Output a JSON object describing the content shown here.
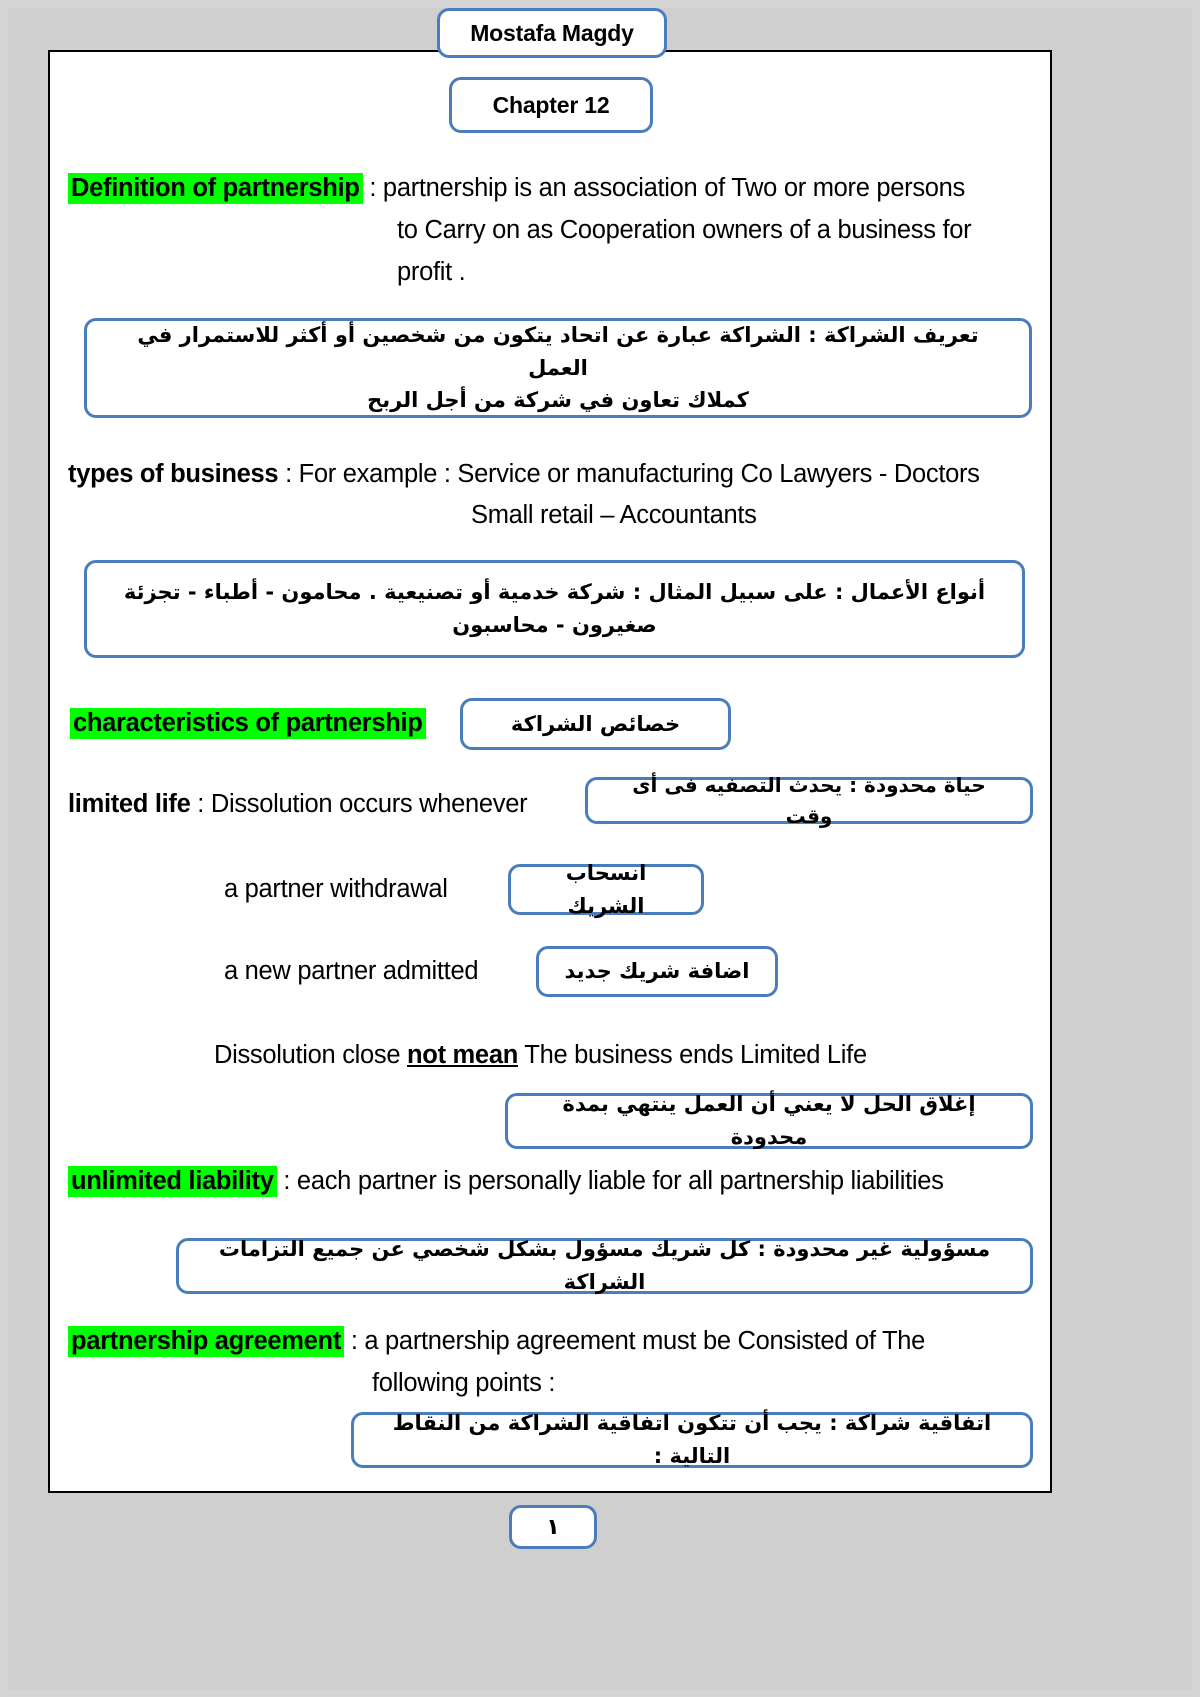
{
  "document": {
    "author_box": "Mostafa Magdy",
    "chapter_box": "Chapter 12",
    "page_number": "١"
  },
  "sections": {
    "definition": {
      "heading": "Definition of partnership",
      "line1_rest": " : partnership is an association of Two or more persons",
      "line2": "to Carry on as Cooperation owners of a business for",
      "line3": "profit .",
      "arabic_line1": "تعريف الشراكة : الشراكة عبارة عن اتحاد يتكون من شخصين أو أكثر للاستمرار في العمل",
      "arabic_line2": "كملاك تعاون في شركة من أجل الربح"
    },
    "types_of_business": {
      "heading": "types of business",
      "line1_rest": " : For example : Service or manufacturing Co Lawyers - Doctors",
      "line2": "Small retail – Accountants",
      "arabic_line1": "أنواع الأعمال : على سبيل المثال : شركة خدمية أو تصنيعية . محامون - أطباء - تجزئة",
      "arabic_line2": "صغيرون - محاسبون"
    },
    "characteristics": {
      "heading": "characteristics of partnership",
      "arabic_box": "خصائص الشراكة"
    },
    "limited_life": {
      "heading": "limited life",
      "line1_rest": " : Dissolution occurs whenever",
      "arabic_box": "حياة محدودة : يحدث التصفيه فى أى وقت",
      "item1": "a partner withdrawal",
      "item1_arabic": "انسحاب الشريك",
      "item2": "a new partner admitted",
      "item2_arabic": "اضافة شريك جديد",
      "note_prefix": "Dissolution close ",
      "note_emphasis": "not mean",
      "note_suffix": " The business ends Limited Life",
      "note_arabic": "إغلاق الحل لا يعني أن العمل ينتهي بمدة محدودة"
    },
    "unlimited_liability": {
      "heading": "unlimited liability",
      "line1_rest": " : each partner is personally liable for all partnership liabilities",
      "arabic_box": "مسؤولية غير محدودة : كل شريك مسؤول بشكل شخصي عن جميع التزامات الشراكة"
    },
    "partnership_agreement": {
      "heading": "partnership agreement",
      "line1_rest": " : a partnership agreement must be Consisted of The",
      "line2": "following points :",
      "arabic_box": "اتفاقية شراكة : يجب أن تتكون اتفاقية الشراكة من النقاط التالية :"
    }
  },
  "colors": {
    "highlight": "#00ff00",
    "box_border": "#4a7ebb",
    "page_background": "#d4d4d4",
    "sheet": "#ffffff",
    "text": "#000000"
  }
}
